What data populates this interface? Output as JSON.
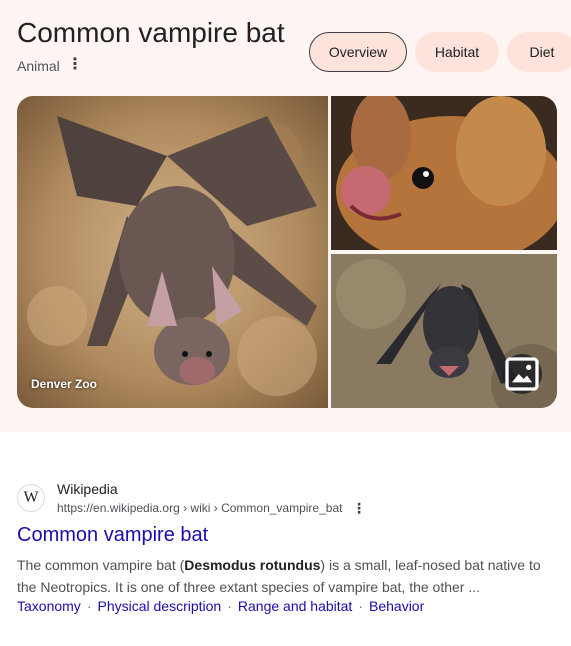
{
  "header": {
    "title": "Common vampire bat",
    "subtitle": "Animal",
    "more_icon": "vertical-dots-icon"
  },
  "chips": [
    {
      "label": "Overview",
      "selected": true
    },
    {
      "label": "Habitat",
      "selected": false
    },
    {
      "label": "Diet",
      "selected": false
    }
  ],
  "gallery": {
    "main_caption": "Denver Zoo",
    "view_images_icon": "image-icon"
  },
  "result": {
    "site_name": "Wikipedia",
    "favicon_letter": "W",
    "url": "https://en.wikipedia.org › wiki › Common_vampire_bat",
    "title": "Common vampire bat",
    "snippet_before": "The common vampire bat (",
    "snippet_bold": "Desmodus rotundus",
    "snippet_after": ") is a small, leaf-nosed bat native to the Neotropics. It is one of three extant species of vampire bat, the other ...",
    "sitelinks": [
      "Taxonomy",
      "Physical description",
      "Range and habitat",
      "Behavior"
    ]
  },
  "colors": {
    "panel_bg": "#fff6f3",
    "chip_bg": "#fde3dc",
    "link": "#1a0dab"
  }
}
